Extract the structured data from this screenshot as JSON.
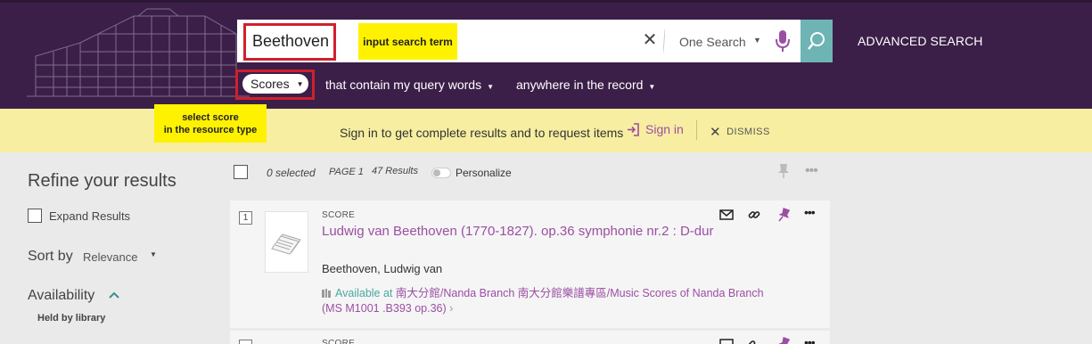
{
  "search": {
    "query": "Beethoven",
    "scope": "One Search",
    "advanced_label": "ADVANCED SEARCH",
    "annotation": "input search term"
  },
  "filters": {
    "resource_type": "Scores",
    "match": "that contain my query words",
    "field": "anywhere in the record",
    "annotation_line1": "select score",
    "annotation_line2": "in the resource type"
  },
  "banner": {
    "message": "Sign in to get complete results and to request items",
    "signin_label": "Sign in",
    "dismiss_label": "DISMISS"
  },
  "sidebar": {
    "title": "Refine your results",
    "expand_label": "Expand Results",
    "sort_label": "Sort by",
    "sort_value": "Relevance",
    "availability_label": "Availability",
    "held_label": "Held by library"
  },
  "toolbar": {
    "selected": "0 selected",
    "page": "PAGE 1",
    "results": "47 Results",
    "personalize": "Personalize"
  },
  "results": [
    {
      "number": "1",
      "type": "SCORE",
      "title": "Ludwig van Beethoven (1770-1827). op.36 symphonie nr.2 : D-dur",
      "author": "Beethoven, Ludwig van",
      "available_label": "Available at",
      "location": "南大分館/Nanda Branch  南大分館樂譜專區/Music Scores of Nanda Branch (MS M1001 .B393 op.36)"
    },
    {
      "number": "",
      "type": "SCORE"
    }
  ],
  "colors": {
    "header_bg": "#3b1f48",
    "accent": "#9b4fa3",
    "teal": "#6fb4b4",
    "banner_bg": "#f7eea1",
    "annotation_bg": "#fff200",
    "highlight_border": "#d0202c"
  }
}
